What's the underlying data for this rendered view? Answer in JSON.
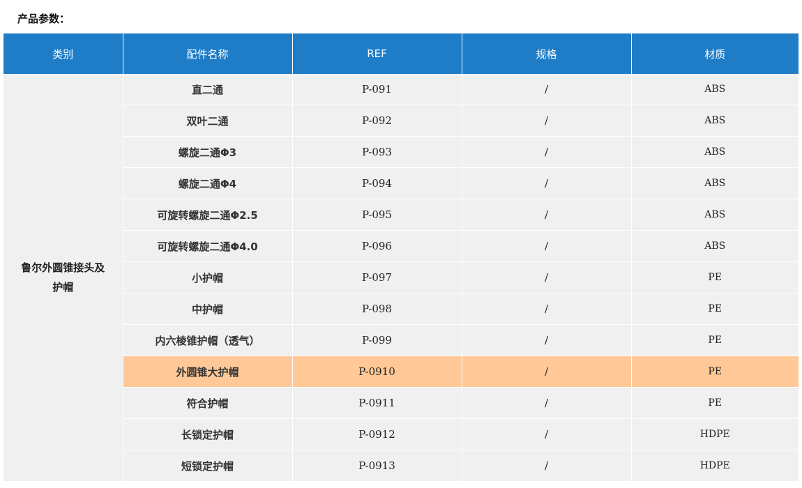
{
  "heading": "产品参数：",
  "columns": [
    "类别",
    "配件名称",
    "REF",
    "规格",
    "材质"
  ],
  "category": "鲁尔外圆锥接头及护帽",
  "rows": [
    {
      "name": "直二通",
      "ref": "P-091",
      "spec": "/",
      "material": "ABS"
    },
    {
      "name": "双叶二通",
      "ref": "P-092",
      "spec": "/",
      "material": "ABS"
    },
    {
      "name": "螺旋二通Φ3",
      "ref": "P-093",
      "spec": "/",
      "material": "ABS"
    },
    {
      "name": "螺旋二通Φ4",
      "ref": "P-094",
      "spec": "/",
      "material": "ABS"
    },
    {
      "name": "可旋转螺旋二通Φ2.5",
      "ref": "P-095",
      "spec": "/",
      "material": "ABS"
    },
    {
      "name": "可旋转螺旋二通Φ4.0",
      "ref": "P-096",
      "spec": "/",
      "material": "ABS"
    },
    {
      "name": "小护帽",
      "ref": "P-097",
      "spec": "/",
      "material": "PE"
    },
    {
      "name": "中护帽",
      "ref": "P-098",
      "spec": "/",
      "material": "PE"
    },
    {
      "name": "内六棱锥护帽（透气）",
      "ref": "P-099",
      "spec": "/",
      "material": "PE"
    },
    {
      "name": "外圆锥大护帽",
      "ref": "P-0910",
      "spec": "/",
      "material": "PE"
    },
    {
      "name": "符合护帽",
      "ref": "P-0911",
      "spec": "/",
      "material": "PE"
    },
    {
      "name": "长锁定护帽",
      "ref": "P-0912",
      "spec": "/",
      "material": "HDPE"
    },
    {
      "name": "短锁定护帽",
      "ref": "P-0913",
      "spec": "/",
      "material": "HDPE"
    }
  ],
  "highlight_color": "#ffc896",
  "header_color": "#1f7dc8"
}
